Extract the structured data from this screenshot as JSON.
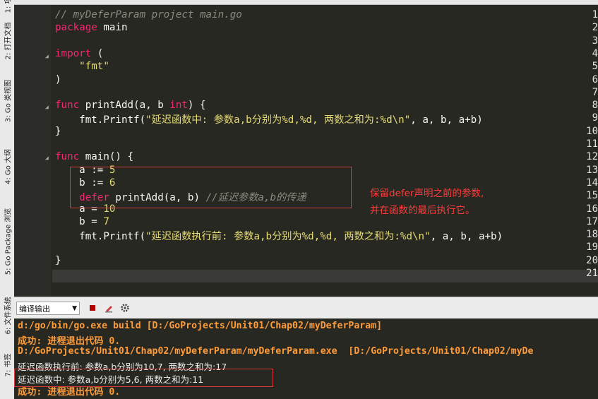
{
  "sidebar": {
    "tabs": [
      "1: 项目",
      "2: 打开文档",
      "3: Go 类视图",
      "4: Go 大纲",
      "5: Go Package 浏览",
      "6: 文件系统",
      "7: 书签"
    ]
  },
  "editor": {
    "lines": [
      {
        "n": "1",
        "code": "// myDeferParam project main.go"
      },
      {
        "n": "2",
        "code": "package main"
      },
      {
        "n": "3",
        "code": ""
      },
      {
        "n": "4",
        "code": "import ("
      },
      {
        "n": "5",
        "code": "    \"fmt\""
      },
      {
        "n": "6",
        "code": ")"
      },
      {
        "n": "7",
        "code": ""
      },
      {
        "n": "8",
        "code": "func printAdd(a, b int) {"
      },
      {
        "n": "9",
        "code": "    fmt.Printf(\"延迟函数中: 参数a,b分别为%d,%d, 两数之和为:%d\\n\", a, b, a+b)"
      },
      {
        "n": "10",
        "code": "}"
      },
      {
        "n": "11",
        "code": ""
      },
      {
        "n": "12",
        "code": "func main() {"
      },
      {
        "n": "13",
        "code": "    a := 5"
      },
      {
        "n": "14",
        "code": "    b := 6"
      },
      {
        "n": "15",
        "code": "    defer printAdd(a, b) //延迟参数a,b的传递"
      },
      {
        "n": "16",
        "code": "    a = 10"
      },
      {
        "n": "17",
        "code": "    b = 7"
      },
      {
        "n": "18",
        "code": "    fmt.Printf(\"延迟函数执行前: 参数a,b分别为%d,%d, 两数之和为:%d\\n\", a, b, a+b)"
      },
      {
        "n": "19",
        "code": ""
      },
      {
        "n": "20",
        "code": "}"
      },
      {
        "n": "21",
        "code": ""
      }
    ],
    "annotation": [
      "保留defer声明之前的参数,",
      "并在函数的最后执行它。"
    ]
  },
  "output": {
    "select_label": "编译输出",
    "lines": [
      "d:/go/bin/go.exe build [D:/GoProjects/Unit01/Chap02/myDeferParam]",
      "成功: 进程退出代码 0.",
      "D:/GoProjects/Unit01/Chap02/myDeferParam/myDeferParam.exe  [D:/GoProjects/Unit01/Chap02/myDe",
      "延迟函数执行前: 参数a,b分别为10,7, 两数之和为:17",
      "延迟函数中: 参数a,b分别为5,6, 两数之和为:11",
      "成功: 进程退出代码 0."
    ]
  },
  "colors": {
    "accent_red": "#ff3b3b",
    "output_orange": "#ff9c3a",
    "keyword": "#f92672",
    "string": "#e6db74",
    "comment": "#8a8a80"
  },
  "icons": [
    "stop-icon",
    "clear-icon",
    "settings-icon"
  ]
}
